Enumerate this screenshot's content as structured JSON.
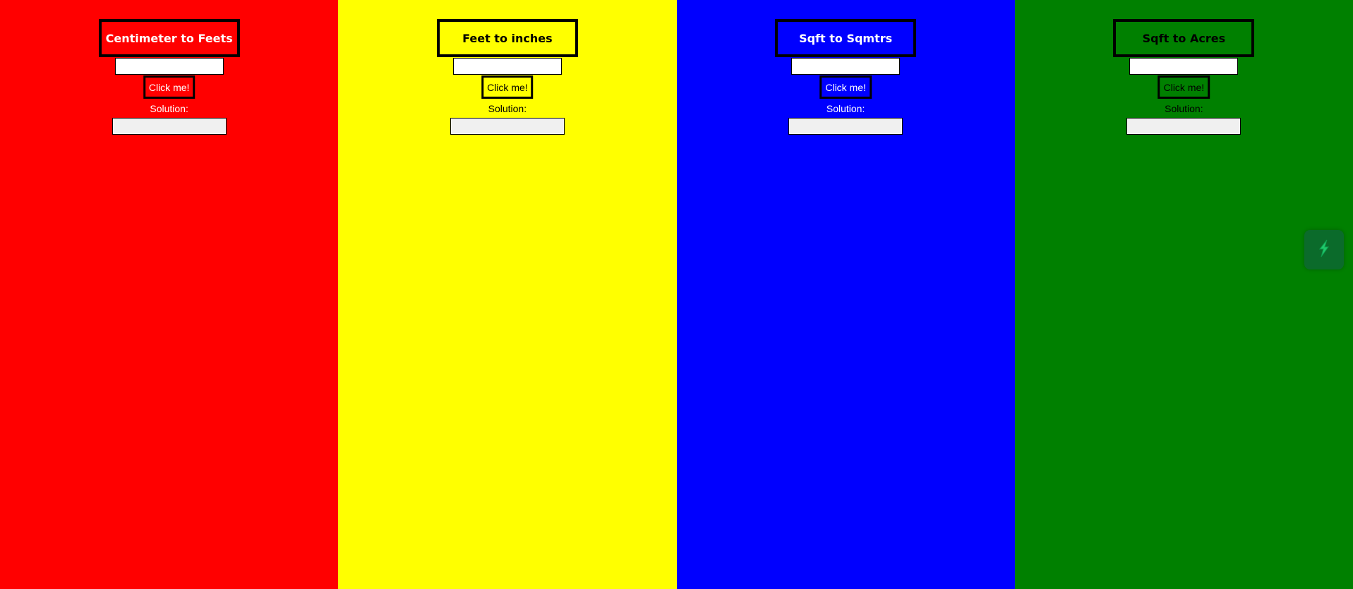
{
  "colors": {
    "red": "#ff0000",
    "yellow": "#ffff00",
    "blue": "#0000ff",
    "green": "#008000",
    "floating_button": "#0b6b2b",
    "floating_icon": "#1ec86a"
  },
  "converters": [
    {
      "title": "Centimeter to Feets",
      "input_value": "",
      "button_label": "Click me!",
      "solution_label": "Solution:",
      "solution_value": ""
    },
    {
      "title": "Feet to inches",
      "input_value": "",
      "button_label": "Click me!",
      "solution_label": "Solution:",
      "solution_value": ""
    },
    {
      "title": "Sqft to Sqmtrs",
      "input_value": "",
      "button_label": "Click me!",
      "solution_label": "Solution:",
      "solution_value": ""
    },
    {
      "title": "Sqft to Acres",
      "input_value": "",
      "button_label": "Click me!",
      "solution_label": "Solution:",
      "solution_value": ""
    }
  ],
  "floating_button": {
    "icon": "lightning-bolt-icon"
  }
}
